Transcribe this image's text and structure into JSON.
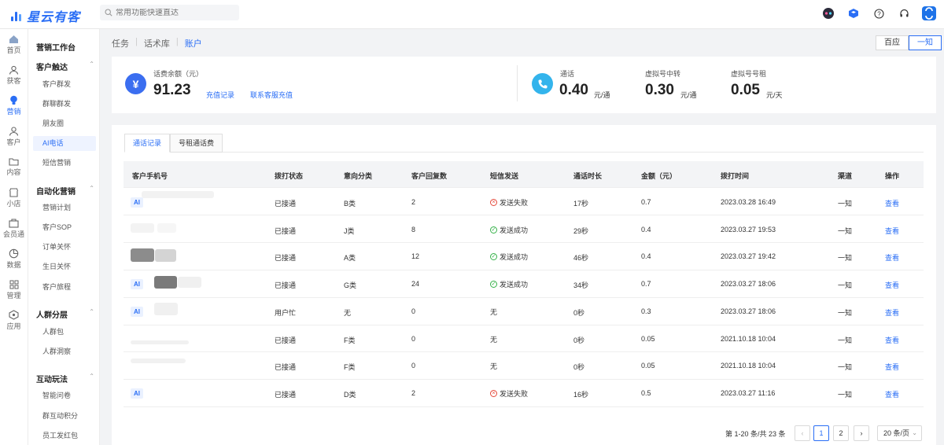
{
  "app": {
    "logo_text": "星云有客",
    "search_placeholder": "常用功能快速直达",
    "accent": "#2a6ef5"
  },
  "rail": [
    {
      "label": "首页",
      "icon": "home-icon"
    },
    {
      "label": "获客",
      "icon": "user-plus-icon"
    },
    {
      "label": "营销",
      "icon": "lightbulb-icon",
      "active": true
    },
    {
      "label": "客户",
      "icon": "person-icon"
    },
    {
      "label": "内容",
      "icon": "folder-icon"
    },
    {
      "label": "小店",
      "icon": "shop-icon"
    },
    {
      "label": "会员通",
      "icon": "member-icon"
    },
    {
      "label": "数据",
      "icon": "pie-chart-icon"
    },
    {
      "label": "管理",
      "icon": "grid-icon"
    },
    {
      "label": "应用",
      "icon": "app-icon"
    }
  ],
  "menu": {
    "title": "营销工作台",
    "groups": [
      {
        "label": "客户触达",
        "items": [
          "客户群发",
          "群聊群发",
          "朋友圈",
          "AI电话",
          "短信营销"
        ]
      },
      {
        "label": "自动化营销",
        "items": [
          "营销计划",
          "客户SOP",
          "订单关怀",
          "生日关怀",
          "客户旅程"
        ]
      },
      {
        "label": "人群分层",
        "items": [
          "人群包",
          "人群洞察"
        ]
      },
      {
        "label": "互动玩法",
        "items": [
          "智能问卷",
          "群互动积分",
          "员工发红包"
        ]
      }
    ],
    "active_item": "AI电话"
  },
  "top_tabs": [
    "任务",
    "话术库",
    "账户"
  ],
  "top_tab_active": "账户",
  "segment": [
    "百应",
    "一知"
  ],
  "segment_active": "一知",
  "balance": {
    "label": "话费余额（元）",
    "value": "91.23",
    "recharge": "充值记录",
    "contact": "联系客服充值",
    "icon": "¥"
  },
  "rates": [
    {
      "label": "通话",
      "value": "0.40",
      "unit": "元/通"
    },
    {
      "label": "虚拟号中转",
      "value": "0.30",
      "unit": "元/通"
    },
    {
      "label": "虚拟号号租",
      "value": "0.05",
      "unit": "元/天"
    }
  ],
  "sub_tabs": [
    "通话记录",
    "号租通话费"
  ],
  "table": {
    "headers": [
      "客户手机号",
      "拨打状态",
      "意向分类",
      "客户回复数",
      "短信发送",
      "通话时长",
      "金额（元）",
      "拨打时间",
      "渠道",
      "操作"
    ],
    "rows": [
      {
        "ai": true,
        "status": "已接通",
        "intent": "B类",
        "replies": "2",
        "sms": "发送失败",
        "sms_state": "fail",
        "duration": "17秒",
        "amount": "0.7",
        "time": "2023.03.28 16:49",
        "channel": "一知",
        "action": "查看"
      },
      {
        "ai": false,
        "status": "已接通",
        "intent": "J类",
        "replies": "8",
        "sms": "发送成功",
        "sms_state": "ok",
        "duration": "29秒",
        "amount": "0.4",
        "time": "2023.03.27 19:53",
        "channel": "一知",
        "action": "查看"
      },
      {
        "ai": false,
        "status": "已接通",
        "intent": "A类",
        "replies": "12",
        "sms": "发送成功",
        "sms_state": "ok",
        "duration": "46秒",
        "amount": "0.4",
        "time": "2023.03.27 19:42",
        "channel": "一知",
        "action": "查看"
      },
      {
        "ai": true,
        "status": "已接通",
        "intent": "G类",
        "replies": "24",
        "sms": "发送成功",
        "sms_state": "ok",
        "duration": "34秒",
        "amount": "0.7",
        "time": "2023.03.27 18:06",
        "channel": "一知",
        "action": "查看"
      },
      {
        "ai": true,
        "status": "用户忙",
        "intent": "无",
        "replies": "0",
        "sms": "无",
        "sms_state": "none",
        "duration": "0秒",
        "amount": "0.3",
        "time": "2023.03.27 18:06",
        "channel": "一知",
        "action": "查看"
      },
      {
        "ai": false,
        "status": "已接通",
        "intent": "F类",
        "replies": "0",
        "sms": "无",
        "sms_state": "none",
        "duration": "0秒",
        "amount": "0.05",
        "time": "2021.10.18 10:04",
        "channel": "一知",
        "action": "查看"
      },
      {
        "ai": false,
        "status": "已接通",
        "intent": "F类",
        "replies": "0",
        "sms": "无",
        "sms_state": "none",
        "duration": "0秒",
        "amount": "0.05",
        "time": "2021.10.18 10:04",
        "channel": "一知",
        "action": "查看"
      },
      {
        "ai": true,
        "status": "已接通",
        "intent": "D类",
        "replies": "2",
        "sms": "发送失败",
        "sms_state": "fail",
        "duration": "16秒",
        "amount": "0.5",
        "time": "2023.03.27 11:16",
        "channel": "一知",
        "action": "查看"
      }
    ]
  },
  "pagination": {
    "summary": "第 1-20 条/共 23 条",
    "pages": [
      "1",
      "2"
    ],
    "current": "1",
    "page_size": "20 条/页"
  }
}
